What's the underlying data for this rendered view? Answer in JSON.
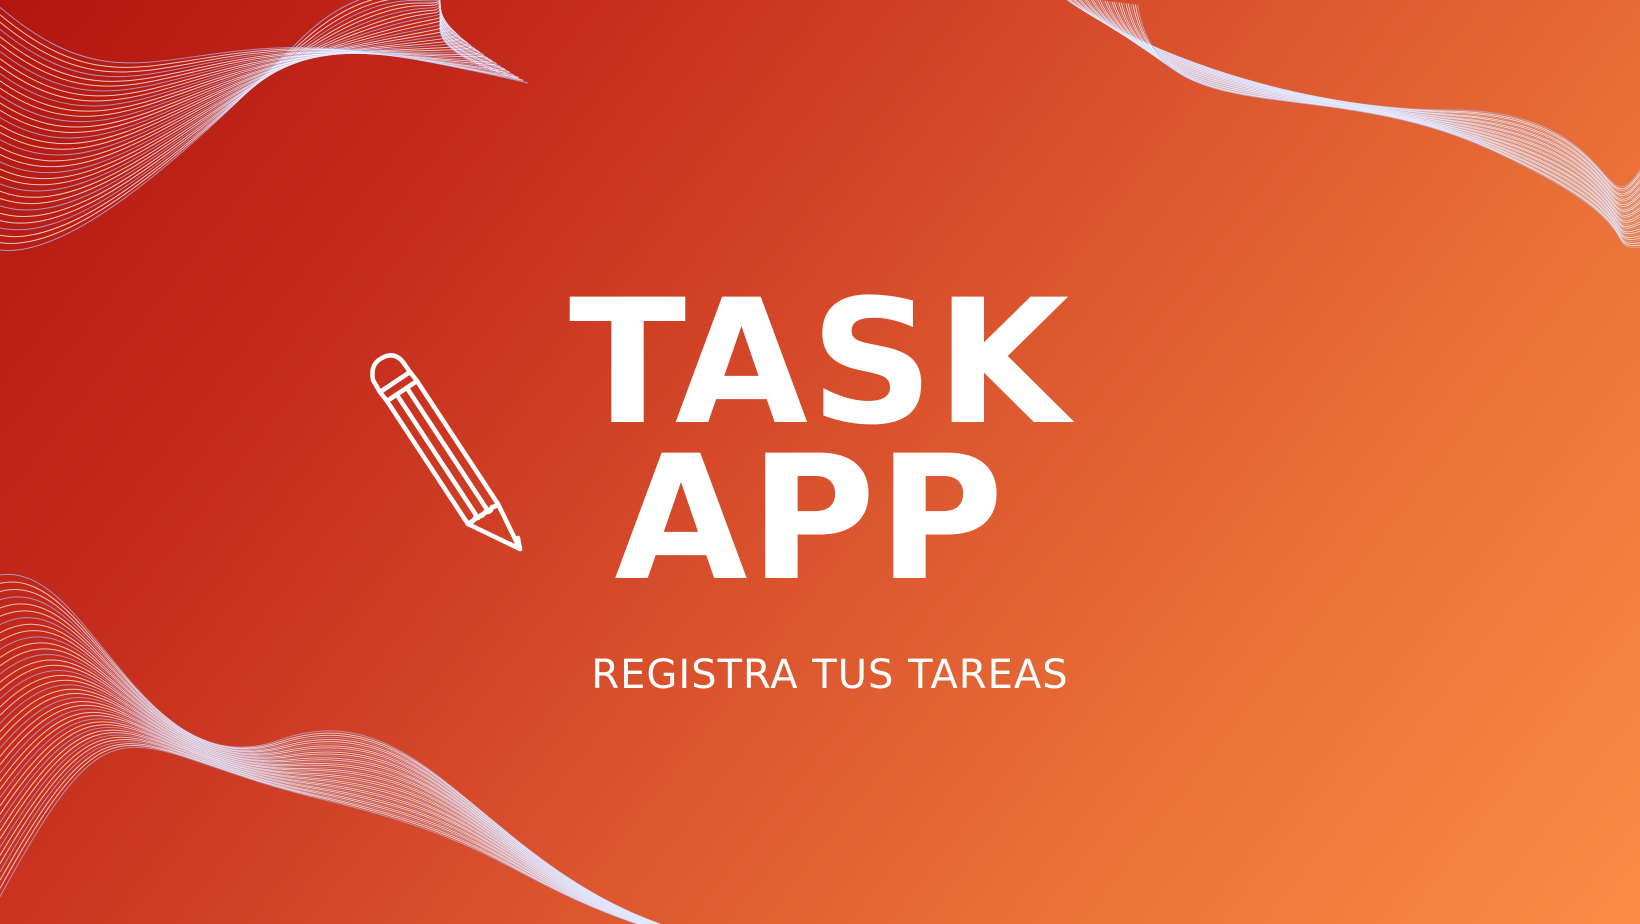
{
  "title": {
    "line1": "TASK",
    "line2": "APP"
  },
  "subtitle": "REGISTRA TUS TAREAS",
  "icon": "pencil-icon",
  "colors": {
    "gradient_start": "#b2160f",
    "gradient_end": "#fb8c45",
    "text": "#ffffff",
    "wave_lines": "#ffffff",
    "wave_tint": "#a9b8ff"
  }
}
